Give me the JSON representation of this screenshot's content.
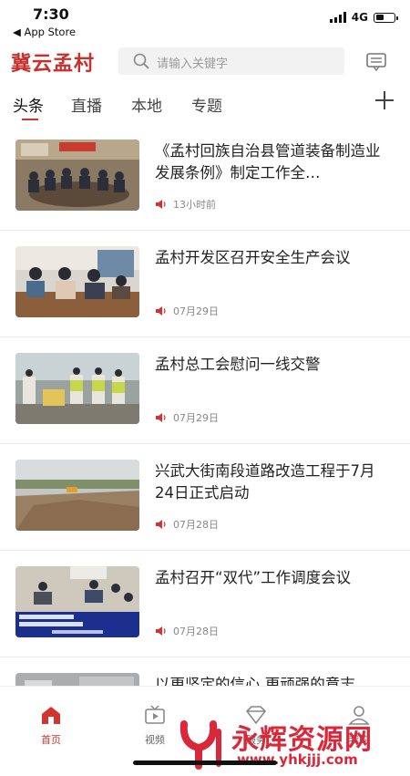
{
  "status_bar": {
    "time": "7:30",
    "back_label": "◀ App Store",
    "network": "4G"
  },
  "header": {
    "logo": "冀云孟村",
    "search_placeholder": "请输入关键字"
  },
  "tabs": [
    {
      "label": "头条",
      "active": true
    },
    {
      "label": "直播",
      "active": false
    },
    {
      "label": "本地",
      "active": false
    },
    {
      "label": "专题",
      "active": false
    }
  ],
  "news": [
    {
      "title": "《孟村回族自治县管道装备制造业发展条例》制定工作全…",
      "date": "13小时前"
    },
    {
      "title": "孟村开发区召开安全生产会议",
      "date": "07月29日"
    },
    {
      "title": "孟村总工会慰问一线交警",
      "date": "07月29日"
    },
    {
      "title": "兴武大街南段道路改造工程于7月24日正式启动",
      "date": "07月28日"
    },
    {
      "title": "孟村召开“双代”工作调度会议",
      "date": "07月28日"
    },
    {
      "title": "以更坚定的信心 更顽强的意志",
      "date": ""
    }
  ],
  "bottom_nav": [
    {
      "label": "首页",
      "icon": "home-icon",
      "active": true
    },
    {
      "label": "视频",
      "icon": "tv-icon",
      "active": false
    },
    {
      "label": "服务",
      "icon": "diamond-icon",
      "active": false
    },
    {
      "label": "我的",
      "icon": "user-icon",
      "active": false
    }
  ],
  "watermark": {
    "text": "永辉资源网",
    "url": "www.yhkjjj.com"
  },
  "colors": {
    "brand": "#c9302c",
    "accent": "#d0352f"
  }
}
